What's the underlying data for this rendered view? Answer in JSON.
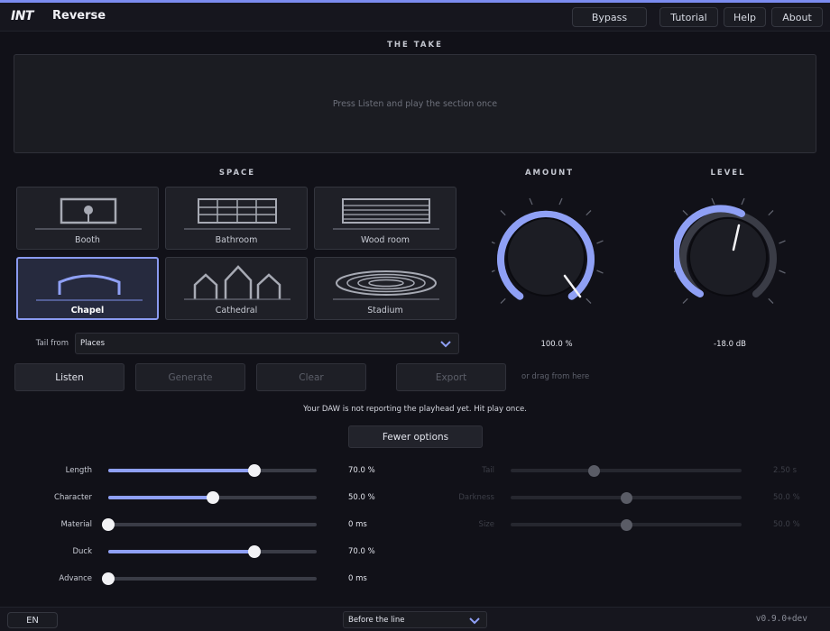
{
  "header": {
    "logo_text": "INT",
    "title": "Reverse",
    "buttons": [
      "Bypass",
      "Tutorial",
      "Help",
      "About"
    ]
  },
  "take": {
    "label": "THE TAKE",
    "prompt": "Press Listen and play the section once"
  },
  "space": {
    "label": "SPACE",
    "options": [
      "Booth",
      "Bathroom",
      "Wood room",
      "Chapel",
      "Cathedral",
      "Stadium"
    ],
    "selected": "Chapel",
    "tail_from_label": "Tail from",
    "tail_from_value": "Places"
  },
  "knobs": {
    "amount": {
      "label": "AMOUNT",
      "value_text": "100.0 %",
      "fraction": 1.0
    },
    "level": {
      "label": "LEVEL",
      "value_text": "-18.0 dB",
      "fraction": 0.7
    }
  },
  "actions": {
    "listen": "Listen",
    "generate": "Generate",
    "clear": "Clear",
    "export": "Export",
    "drag_hint": "or drag from here"
  },
  "status_message": "Your DAW is not reporting the playhead yet. Hit play once.",
  "options_toggle": "Fewer options",
  "sliders_left": [
    {
      "label": "Length",
      "value_text": "70.0 %",
      "fraction": 0.7
    },
    {
      "label": "Character",
      "value_text": "50.0 %",
      "fraction": 0.5
    },
    {
      "label": "Material",
      "value_text": "0 ms",
      "fraction": 0.0
    },
    {
      "label": "Duck",
      "value_text": "70.0 %",
      "fraction": 0.7
    },
    {
      "label": "Advance",
      "value_text": "0 ms",
      "fraction": 0.0
    }
  ],
  "sliders_right": [
    {
      "label": "Tail",
      "value_text": "2.50 s",
      "fraction": 0.36
    },
    {
      "label": "Darkness",
      "value_text": "50.0 %",
      "fraction": 0.5
    },
    {
      "label": "Size",
      "value_text": "50.0 %",
      "fraction": 0.5
    }
  ],
  "footer": {
    "language": "EN",
    "placement": "Before the line",
    "version": "v0.9.0+dev"
  },
  "colors": {
    "accent": "#8fa0f5",
    "background": "#111118",
    "panel": "#1b1c22"
  }
}
